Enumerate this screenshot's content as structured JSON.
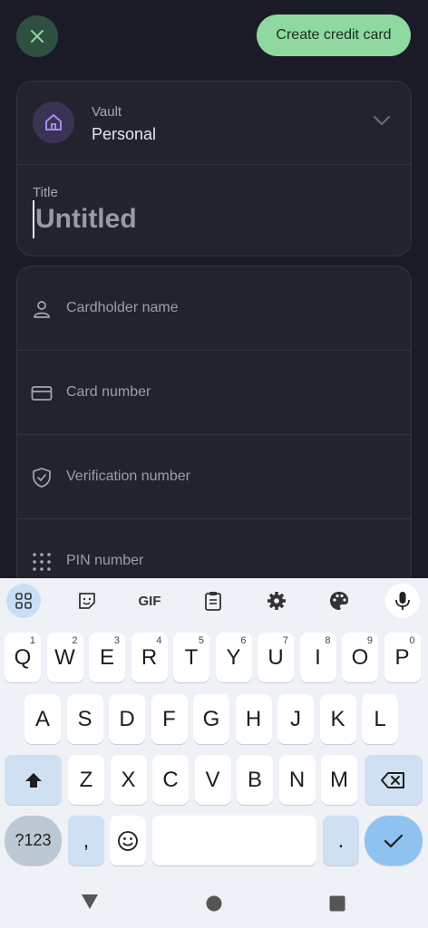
{
  "header": {
    "create_label": "Create credit card"
  },
  "vault": {
    "label": "Vault",
    "value": "Personal"
  },
  "title": {
    "label": "Title",
    "placeholder": "Untitled"
  },
  "fields": [
    {
      "placeholder": "Cardholder name",
      "icon": "person-icon"
    },
    {
      "placeholder": "Card number",
      "icon": "credit-card-icon"
    },
    {
      "placeholder": "Verification number",
      "icon": "shield-check-icon"
    },
    {
      "placeholder": "PIN number",
      "icon": "keypad-dots-icon"
    }
  ],
  "keyboard": {
    "toolbar": {
      "gif_label": "GIF"
    },
    "row1": [
      {
        "key": "Q",
        "hint": "1"
      },
      {
        "key": "W",
        "hint": "2"
      },
      {
        "key": "E",
        "hint": "3"
      },
      {
        "key": "R",
        "hint": "4"
      },
      {
        "key": "T",
        "hint": "5"
      },
      {
        "key": "Y",
        "hint": "6"
      },
      {
        "key": "U",
        "hint": "7"
      },
      {
        "key": "I",
        "hint": "8"
      },
      {
        "key": "O",
        "hint": "9"
      },
      {
        "key": "P",
        "hint": "0"
      }
    ],
    "row2": [
      "A",
      "S",
      "D",
      "F",
      "G",
      "H",
      "J",
      "K",
      "L"
    ],
    "row3": [
      "Z",
      "X",
      "C",
      "V",
      "B",
      "N",
      "M"
    ],
    "bottom": {
      "numbers_label": "?123",
      "comma": ",",
      "period": "."
    }
  },
  "colors": {
    "accent": "#8fd9a0",
    "background": "#1b1b27",
    "vault_icon": "#a58bf2"
  }
}
